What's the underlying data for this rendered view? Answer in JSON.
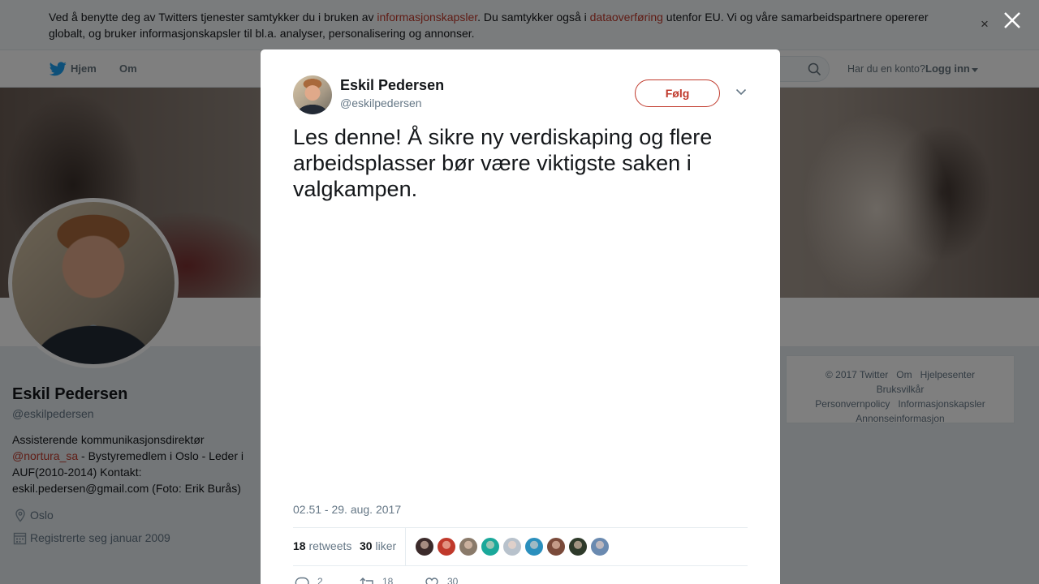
{
  "cookie_bar": {
    "text_1": "Ved å benytte deg av Twitters tjenester samtykker du i bruken av ",
    "link_1": "informasjonskapsler",
    "text_2": ". Du samtykker også i ",
    "link_2": "dataoverføring",
    "text_3": " utenfor EU. Vi og våre samarbeidspartnere opererer globalt, og bruker informasjonskapsler til bl.a. analyser, personalisering og annonser.",
    "close": "×"
  },
  "nav": {
    "home": "Hjem",
    "about": "Om",
    "have_account": "Har du en konto?",
    "login": "Logg inn"
  },
  "profile": {
    "name": "Eskil Pedersen",
    "handle": "@eskilpedersen",
    "bio_1": "Assisterende kommunikasjonsdirektør ",
    "bio_mention": "@nortura_sa",
    "bio_2": " - Bystyremedlem i Oslo - Leder i AUF(2010-2014) Kontakt: eskil.pedersen@gmail.com (Foto: Erik Burås)",
    "location": "Oslo",
    "joined": "Registrerte seg januar 2009"
  },
  "footer": {
    "links": [
      "© 2017 Twitter",
      "Om",
      "Hjelpesenter",
      "Bruksvilkår",
      "Personvernpolicy",
      "Informasjonskapsler",
      "Annonseinformasjon"
    ]
  },
  "tweet": {
    "author_name": "Eskil Pedersen",
    "author_handle": "@eskilpedersen",
    "follow_label": "Følg",
    "text": "Les denne! Å sikre ny verdiskaping og flere arbeidsplasser bør være viktigste saken i valgkampen.",
    "timestamp": "02.51 - 29. aug. 2017",
    "retweets_count": "18",
    "retweets_label": "retweets",
    "likes_count": "30",
    "likes_label": "liker",
    "reply_count": "2",
    "retweet_count_action": "18",
    "like_count_action": "30",
    "liker_colors": [
      "#3b2a2a",
      "#c0392b",
      "#8a7a6a",
      "#1aa89a",
      "#b8c2cc",
      "#2a8fbd",
      "#7a4a3a",
      "#2e3a2a",
      "#6a8ab0"
    ]
  },
  "colors": {
    "accent": "#c0392b",
    "muted": "#657786",
    "overlay": "rgba(0,0,0,0.5)"
  }
}
